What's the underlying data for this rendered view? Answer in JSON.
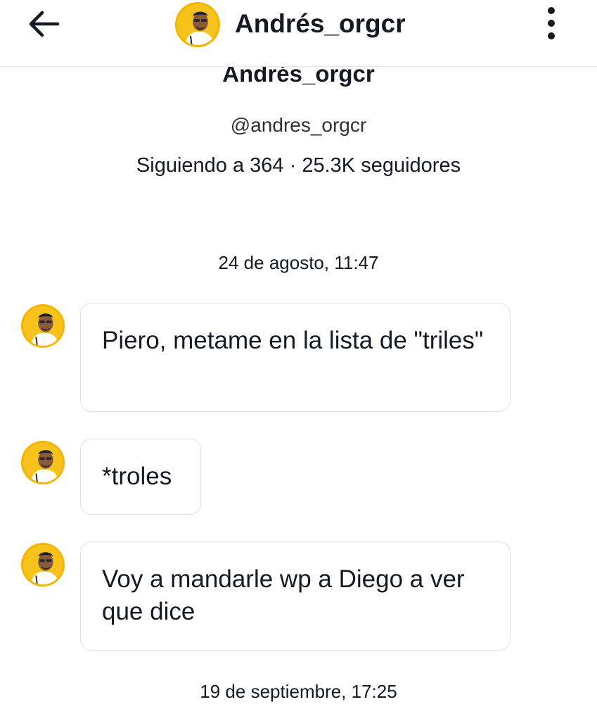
{
  "header": {
    "title": "Andrés_orgcr",
    "back_icon": "arrow-left-icon",
    "menu_icon": "more-vertical-icon"
  },
  "profile": {
    "name": "Andrés_orgcr",
    "handle": "@andres_orgcr",
    "following_text": "Siguiendo a 364",
    "separator": "·",
    "followers_text": "25.3K seguidores"
  },
  "conversation": {
    "timestamps": [
      "24 de agosto, 11:47",
      "19 de septiembre, 17:25"
    ],
    "messages": [
      {
        "sender": "Andrés_orgcr",
        "text": "Piero, metame en la lista de \"triles\""
      },
      {
        "sender": "Andrés_orgcr",
        "text": "*troles"
      },
      {
        "sender": "Andrés_orgcr",
        "text": "Voy a mandarle wp a Diego a ver que dice"
      }
    ]
  },
  "colors": {
    "text": "#161823",
    "border": "#e1e1e3",
    "avatar_ring": "#f5b400"
  }
}
